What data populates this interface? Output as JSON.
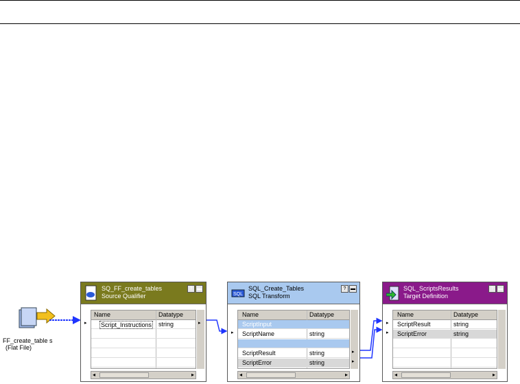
{
  "source": {
    "line1": "FF_create_table s",
    "line2": "(Flat File)"
  },
  "qualifier": {
    "title1": "SQ_FF_create_tables",
    "title2": "Source Qualifier",
    "col_name": "Name",
    "col_type": "Datatype",
    "rows": [
      {
        "name": "Script_Instructions",
        "type": "string"
      }
    ],
    "color": "#7a7a1e"
  },
  "sqltx": {
    "title1": "SQL_Create_Tables",
    "title2": "SQL Transform",
    "col_name": "Name",
    "col_type": "Datatype",
    "group_input": "ScriptInput",
    "group_output": "",
    "rows": [
      {
        "name": "ScriptName",
        "type": "string"
      },
      {
        "name": "ScriptResult",
        "type": "string"
      },
      {
        "name": "ScriptError",
        "type": "string"
      }
    ],
    "color": "#a9c9ef"
  },
  "target": {
    "title1": "SQL_ScriptsResults",
    "title2": "Target Definition",
    "col_name": "Name",
    "col_type": "Datatype",
    "rows": [
      {
        "name": "ScriptResult",
        "type": "string"
      },
      {
        "name": "ScriptError",
        "type": "string"
      }
    ],
    "color": "#8a1a8a"
  },
  "icons": [
    "flat-file-icon",
    "source-qualifier-icon",
    "sql-transform-icon",
    "target-definition-icon"
  ]
}
